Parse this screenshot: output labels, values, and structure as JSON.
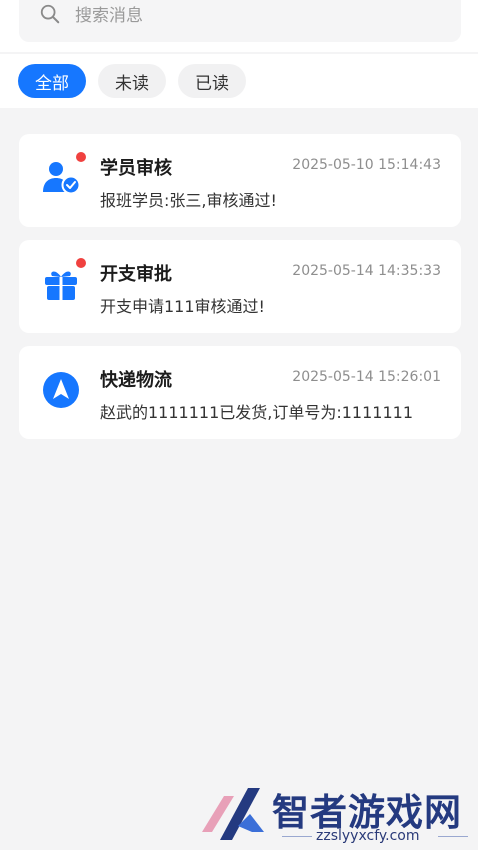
{
  "search": {
    "placeholder": "搜索消息"
  },
  "tabs": [
    {
      "label": "全部",
      "active": true
    },
    {
      "label": "未读",
      "active": false
    },
    {
      "label": "已读",
      "active": false
    }
  ],
  "messages": [
    {
      "icon": "user-check-icon",
      "unread": true,
      "title": "学员审核",
      "time": "2025-05-10 15:14:43",
      "content": "报班学员:张三,审核通过!"
    },
    {
      "icon": "gift-icon",
      "unread": true,
      "title": "开支审批",
      "time": "2025-05-14 14:35:33",
      "content": "开支申请111审核通过!"
    },
    {
      "icon": "navigation-arrow-icon",
      "unread": false,
      "title": "快递物流",
      "time": "2025-05-14 15:26:01",
      "content": "赵武的1111111已发货,订单号为:1111111"
    }
  ],
  "colors": {
    "accent": "#1677ff",
    "badge": "#f0413f",
    "background": "#f4f4f5"
  },
  "watermark": {
    "title": "智者游戏网",
    "url": "zzslyyxcfy.com"
  }
}
